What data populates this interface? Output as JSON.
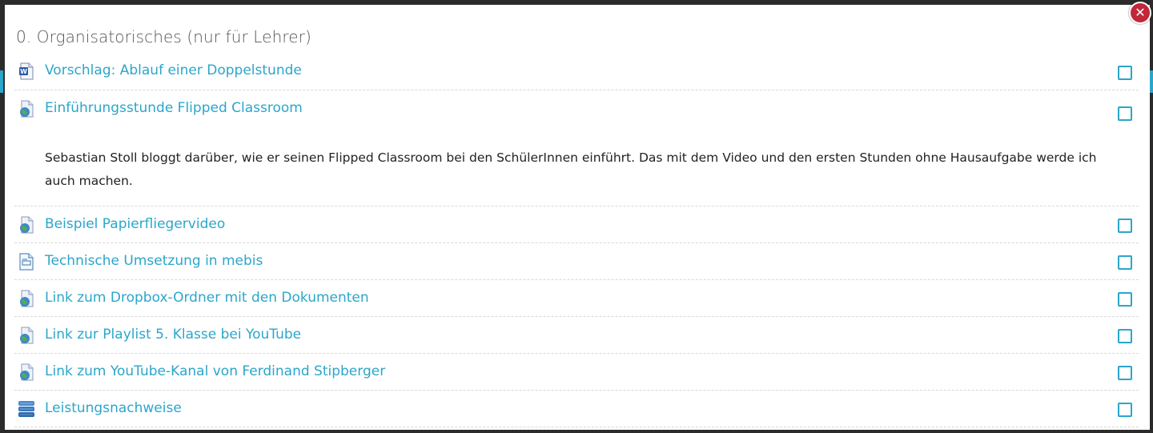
{
  "section": {
    "title": "0. Organisatorisches (nur für Lehrer)"
  },
  "close_button": {
    "label": "✕"
  },
  "items": [
    {
      "label": "Vorschlag: Ablauf einer Doppelstunde",
      "icon": "word-document-icon"
    },
    {
      "label": "Einführungsstunde Flipped Classroom",
      "icon": "url-link-icon",
      "description": "Sebastian Stoll bloggt darüber, wie er seinen Flipped Classroom bei den SchülerInnen einführt. Das mit dem Video und den ersten Stunden ohne Hausaufgabe werde ich auch machen."
    },
    {
      "label": "Beispiel Papierfliegervideo",
      "icon": "url-link-icon"
    },
    {
      "label": "Technische Umsetzung in mebis",
      "icon": "page-icon"
    },
    {
      "label": "Link zum Dropbox-Ordner mit den Dokumenten",
      "icon": "url-link-icon"
    },
    {
      "label": "Link zur Playlist 5. Klasse bei YouTube",
      "icon": "url-link-icon"
    },
    {
      "label": "Link zum YouTube-Kanal von Ferdinand Stipberger",
      "icon": "url-link-icon"
    },
    {
      "label": "Leistungsnachweise",
      "icon": "database-icon"
    }
  ],
  "colors": {
    "link": "#2ba6cb",
    "close": "#c0283a",
    "text": "#222222",
    "title": "#555555"
  }
}
